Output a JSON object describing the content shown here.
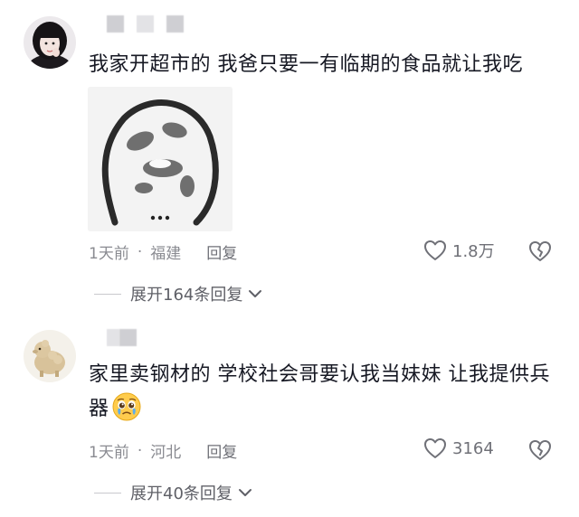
{
  "comments": [
    {
      "text": "我家开超市的 我爸只要一有临期的食品就让我吃",
      "time": "1天前",
      "location": "福建",
      "reply_label": "回复",
      "like_count": "1.8万",
      "expand_label": "展开164条回复",
      "sticker_icon": "doodle-face-sticker"
    },
    {
      "text": "家里卖钢材的 学校社会哥要认我当妹妹 让我提供兵器",
      "time": "1天前",
      "location": "河北",
      "reply_label": "回复",
      "like_count": "3164",
      "expand_label": "展开40条回复",
      "emoji_icon": "pleading-crying-face"
    }
  ],
  "separator": "·",
  "colors": {
    "text": "#161823",
    "meta": "#8a8b91",
    "background": "#ffffff"
  }
}
